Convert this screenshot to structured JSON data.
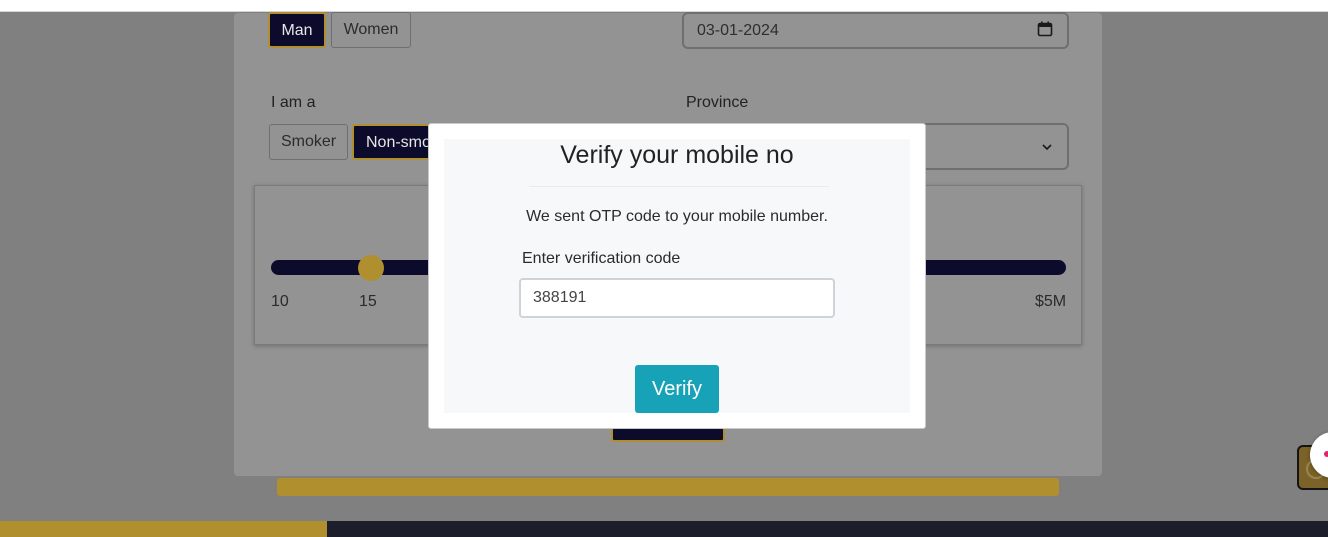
{
  "form": {
    "gender_options": [
      "Man",
      "Women"
    ],
    "gender_selected": "Man",
    "date_value": "03-01-2024",
    "smoker_label": "I am a",
    "smoker_options": [
      "Smoker",
      "Non-smo"
    ],
    "smoker_selected": "Non-smo",
    "province_label": "Province",
    "province_value": ""
  },
  "slider": {
    "min_label": "10",
    "thumb_label": "15",
    "max_label": "$5M",
    "value": 15
  },
  "modal": {
    "title": "Verify your mobile no",
    "message": "We sent OTP code to your mobile number.",
    "code_label": "Enter verification code",
    "code_value": "388191",
    "verify_label": "Verify"
  },
  "colors": {
    "dark_navy": "#0d0b2b",
    "gold": "#b08f2e",
    "verify_teal": "#17a2b8",
    "footer_dark": "#1c1f2b"
  },
  "icons": {
    "calendar": "calendar-icon",
    "dropdown": "chevron-down-icon"
  }
}
